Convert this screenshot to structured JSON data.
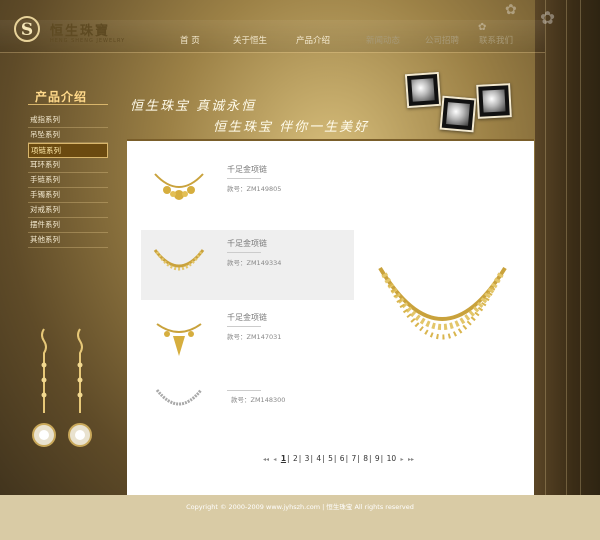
{
  "brand": {
    "name": "恒生珠寶",
    "sub": "HENG SHENG JEWELRY"
  },
  "nav": [
    {
      "label": "首 页"
    },
    {
      "label": "关于恒生"
    },
    {
      "label": "产品介绍"
    },
    {
      "label": "新闻动态"
    },
    {
      "label": "公司招聘"
    },
    {
      "label": "联系我们"
    }
  ],
  "banner": {
    "line1": "恒生珠宝  真诚永恒",
    "line2": "恒生珠宝  伴你一生美好"
  },
  "sidebar": {
    "title": "产品介绍",
    "items": [
      {
        "label": "戒指系列"
      },
      {
        "label": "吊坠系列"
      },
      {
        "label": "项链系列"
      },
      {
        "label": "耳环系列"
      },
      {
        "label": "手链系列"
      },
      {
        "label": "手镯系列"
      },
      {
        "label": "对戒系列"
      },
      {
        "label": "摆件系列"
      },
      {
        "label": "其他系列"
      }
    ]
  },
  "products": [
    {
      "name": "千足金项链",
      "code": "款号：ZM149805"
    },
    {
      "name": "千足金项链",
      "code": "款号：ZM149334"
    },
    {
      "name": "千足金项链",
      "code": "款号：ZM147031"
    },
    {
      "name": "",
      "code": "款号：ZM148300"
    }
  ],
  "pager": {
    "first": "◂◂",
    "prev": "◂",
    "next": "▸",
    "last": "▸▸",
    "pages": [
      "1",
      "2",
      "3",
      "4",
      "5",
      "6",
      "7",
      "8",
      "9",
      "10"
    ]
  },
  "footer": {
    "text": "Copyright © 2000-2009 www.jyhszh.com | 恒生珠宝  All rights reserved"
  },
  "colors": {
    "gold": "#d8b56b",
    "accent": "#6b4a10",
    "footer": "#d9cba5"
  }
}
